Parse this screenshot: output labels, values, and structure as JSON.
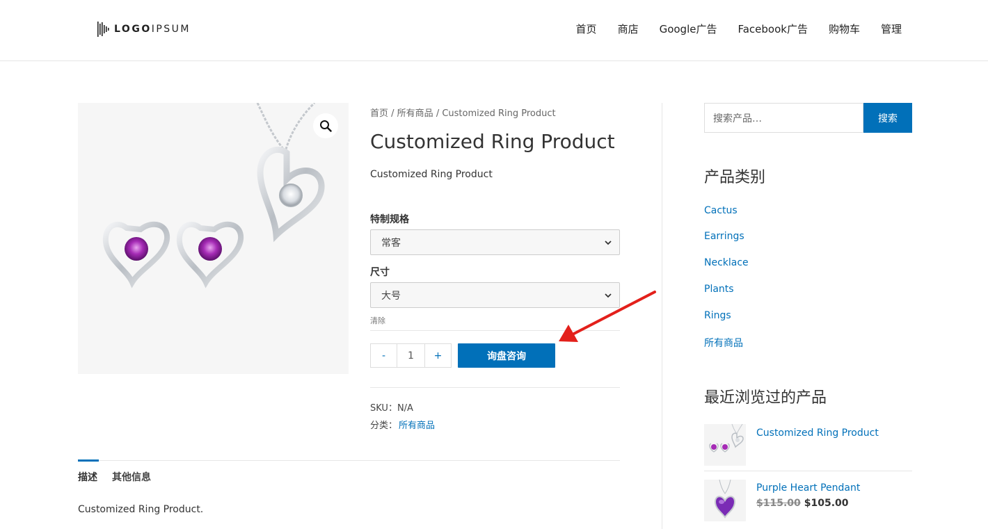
{
  "header": {
    "logo_text_bold": "LOGO",
    "logo_text_light": "IPSUM",
    "nav": [
      "首页",
      "商店",
      "Google广告",
      "Facebook广告",
      "购物车",
      "管理"
    ]
  },
  "breadcrumb": {
    "home": "首页",
    "category": "所有商品",
    "sep": " / ",
    "current": "Customized Ring Product"
  },
  "product": {
    "title": "Customized Ring Product",
    "short_desc": "Customized Ring Product",
    "variation1_label": "特制规格",
    "variation1_value": "常客",
    "variation2_label": "尺寸",
    "variation2_value": "大号",
    "clear_label": "清除",
    "qty_minus": "-",
    "qty_value": "1",
    "qty_plus": "+",
    "inquiry_button": "询盘咨询",
    "sku_label": "SKU：",
    "sku_value": "N/A",
    "category_label": "分类：",
    "category_value": "所有商品"
  },
  "tabs": {
    "description": "描述",
    "additional": "其他信息",
    "content": "Customized Ring Product."
  },
  "sidebar": {
    "search_placeholder": "搜索产品…",
    "search_button": "搜索",
    "categories_title": "产品类别",
    "categories": [
      "Cactus",
      "Earrings",
      "Necklace",
      "Plants",
      "Rings",
      "所有商品"
    ],
    "recent_title": "最近浏览过的产品",
    "recent": [
      {
        "name": "Customized Ring Product"
      },
      {
        "name": "Purple Heart Pendant",
        "old_price": "$115.00",
        "price": "$105.00"
      }
    ]
  },
  "colors": {
    "accent": "#0170b9",
    "arrow": "#e3201b"
  },
  "icons": {
    "zoom": "magnifier-icon",
    "select": "chevron-down-icon"
  }
}
